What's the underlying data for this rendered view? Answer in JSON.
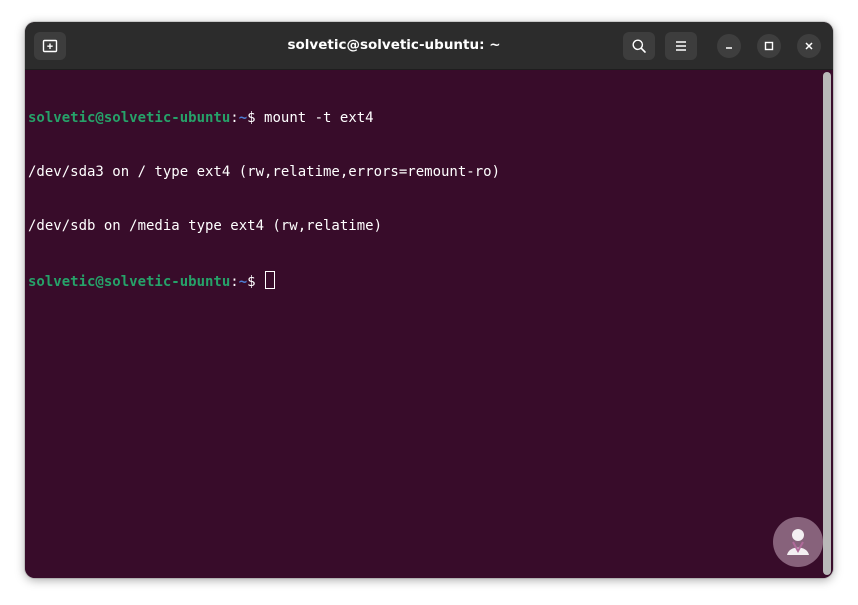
{
  "window": {
    "title": "solvetic@solvetic-ubuntu: ~"
  },
  "headerbar": {
    "new_tab_icon": "new-tab-icon",
    "search_icon": "search-icon",
    "menu_icon": "hamburger-menu-icon",
    "minimize_icon": "minimize-icon",
    "maximize_icon": "maximize-icon",
    "close_icon": "close-icon"
  },
  "terminal": {
    "lines": [
      {
        "user": "solvetic@solvetic-ubuntu",
        "sep": ":",
        "path": "~",
        "dollar": "$ ",
        "command": "mount -t ext4"
      },
      {
        "output": "/dev/sda3 on / type ext4 (rw,relatime,errors=remount-ro)"
      },
      {
        "output": "/dev/sdb on /media type ext4 (rw,relatime)"
      },
      {
        "user": "solvetic@solvetic-ubuntu",
        "sep": ":",
        "path": "~",
        "dollar": "$ ",
        "command": ""
      }
    ]
  },
  "colors": {
    "background": "#380c2a",
    "prompt_user": "#26a269",
    "prompt_path": "#4e7fd4",
    "text": "#ffffff",
    "headerbar": "#2c2c2c"
  },
  "watermark": {
    "logo": "solvetic-logo"
  }
}
